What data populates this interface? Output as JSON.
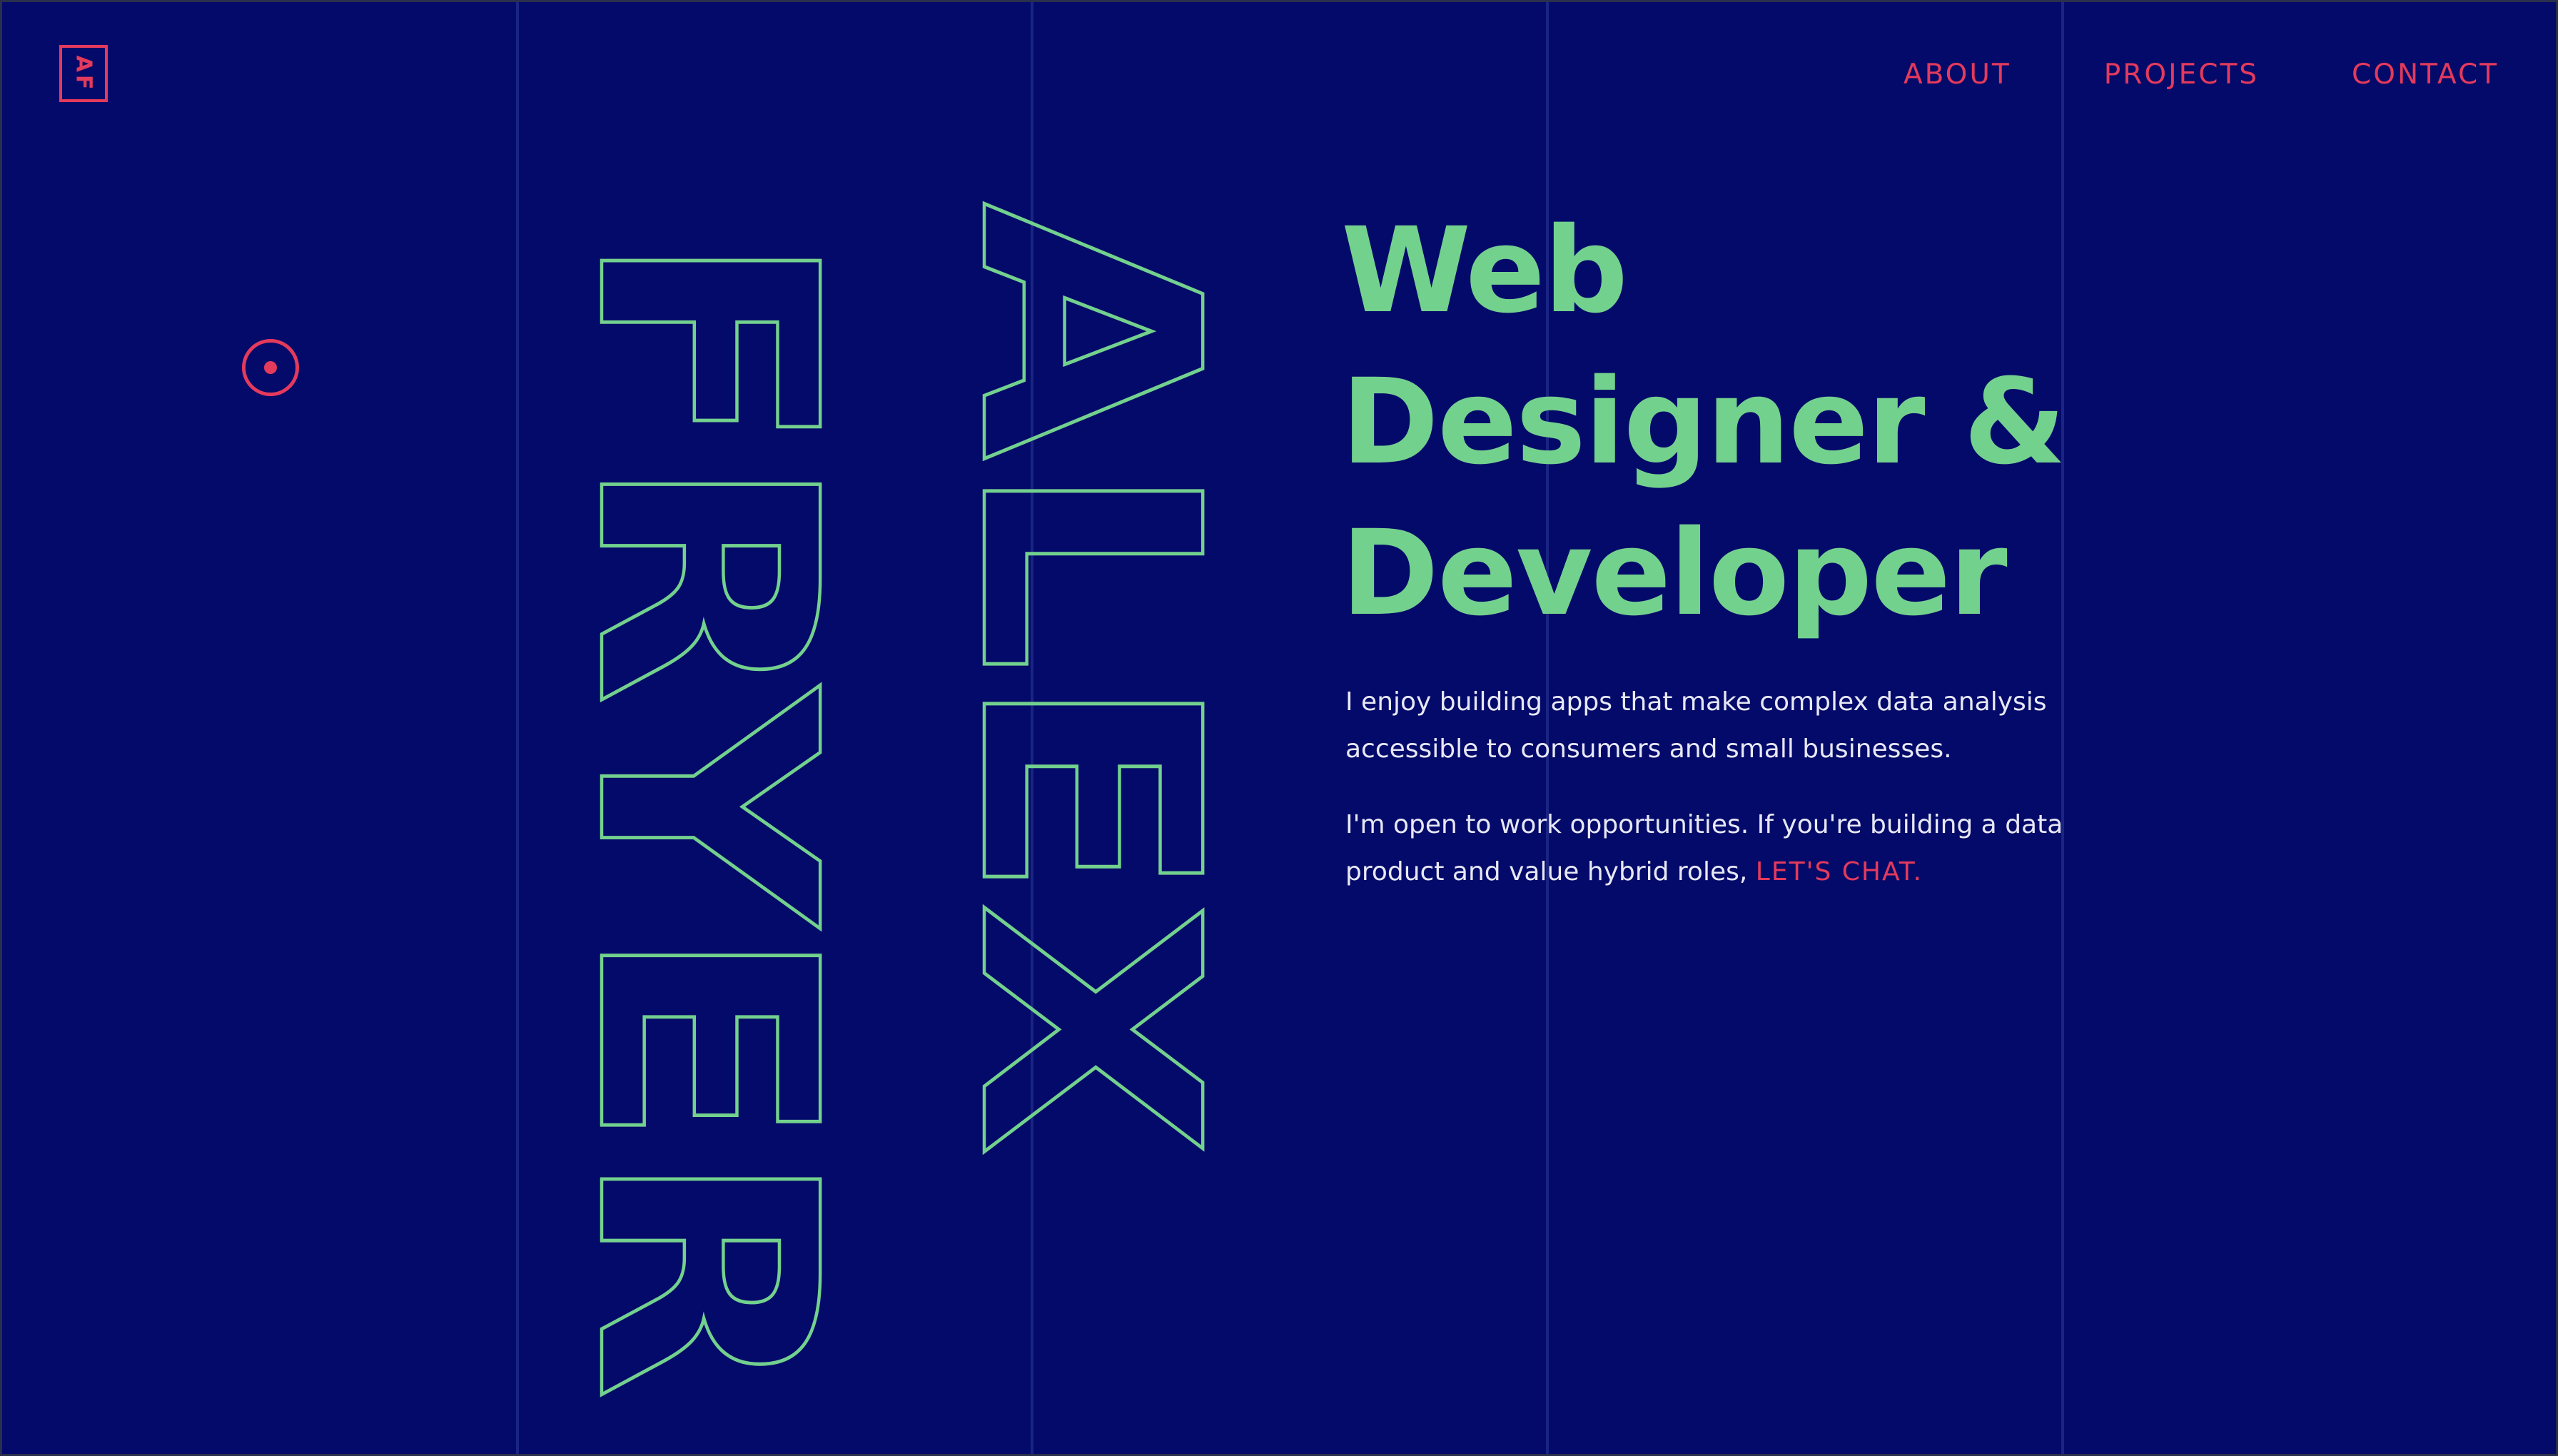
{
  "logo": {
    "text": "AF"
  },
  "nav": {
    "about": "ABOUT",
    "projects": "PROJECTS",
    "contact": "CONTACT"
  },
  "decor": {
    "target_icon": "target-icon"
  },
  "name": {
    "first": "ALEX",
    "last": "FRYER"
  },
  "headline": {
    "line1": "Web",
    "line2": "Designer &",
    "line3": "Developer"
  },
  "intro": {
    "paragraph1": "I enjoy building apps that make complex data analysis accessible to consumers and small businesses.",
    "paragraph2": "I'm open to work opportunities. If you're building a data product and value hybrid roles, ",
    "cta": "LET'S CHAT."
  },
  "colors": {
    "background": "#040a69",
    "accent_green": "#73d18e",
    "accent_red": "#e43a5c",
    "body_text": "#e7e8f5"
  }
}
